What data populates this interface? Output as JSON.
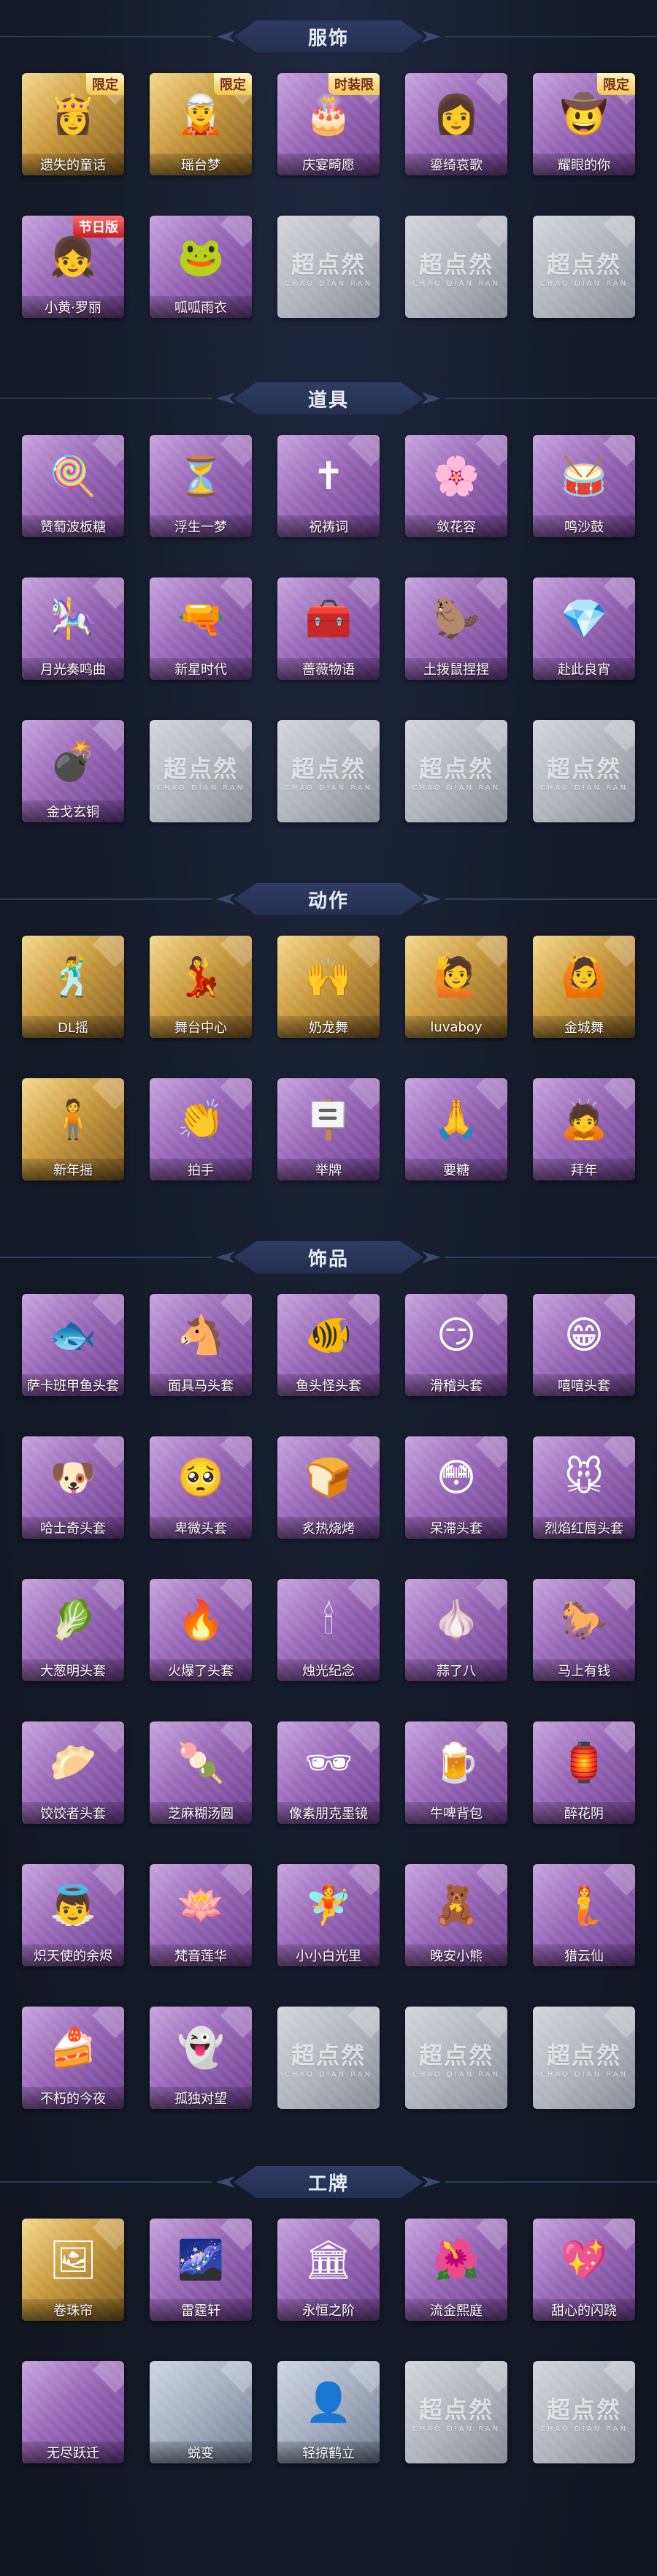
{
  "sections": [
    {
      "title": "服饰",
      "items": [
        {
          "label": "遗失的童话",
          "rarity": "gold",
          "badge": "限定",
          "icon": "princess-avatar",
          "glyph": "👸"
        },
        {
          "label": "瑶台梦",
          "rarity": "gold",
          "badge": "限定",
          "icon": "silver-hair-avatar",
          "glyph": "🧝"
        },
        {
          "label": "庆宴畸愿",
          "rarity": "purple",
          "badge": "时装限",
          "icon": "cake-boy-avatar",
          "glyph": "🎂"
        },
        {
          "label": "鎏绮哀歌",
          "rarity": "purple",
          "badge": "",
          "icon": "lady-avatar",
          "glyph": "👩"
        },
        {
          "label": "耀眼的你",
          "rarity": "purple",
          "badge": "限定",
          "icon": "cowboy-hat-avatar",
          "glyph": "🤠"
        },
        {
          "label": "小黄·罗丽",
          "rarity": "purple",
          "badge": "节日版",
          "icon": "lolita-avatar",
          "glyph": "👧"
        },
        {
          "label": "呱呱雨衣",
          "rarity": "purple",
          "badge": "",
          "icon": "frog-raincoat-avatar",
          "glyph": "🐸"
        },
        {
          "label": "",
          "rarity": "gray",
          "placeholder": true
        },
        {
          "label": "",
          "rarity": "gray",
          "placeholder": true
        },
        {
          "label": "",
          "rarity": "gray",
          "placeholder": true
        }
      ]
    },
    {
      "title": "道具",
      "items": [
        {
          "label": "赞萄波板糖",
          "rarity": "purple",
          "icon": "lollipop-wand",
          "glyph": "🍭"
        },
        {
          "label": "浮生一梦",
          "rarity": "purple",
          "icon": "hourglass",
          "glyph": "⏳"
        },
        {
          "label": "祝祷词",
          "rarity": "purple",
          "icon": "cross-necklace",
          "glyph": "✝"
        },
        {
          "label": "敛花容",
          "rarity": "purple",
          "icon": "hairpin",
          "glyph": "🌸"
        },
        {
          "label": "鸣沙鼓",
          "rarity": "purple",
          "icon": "drum-charm",
          "glyph": "🥁"
        },
        {
          "label": "月光奏鸣曲",
          "rarity": "purple",
          "icon": "music-box",
          "glyph": "🎠"
        },
        {
          "label": "新星时代",
          "rarity": "purple",
          "icon": "revolver",
          "glyph": "🔫"
        },
        {
          "label": "蔷薇物语",
          "rarity": "purple",
          "icon": "medical-box",
          "glyph": "🧰"
        },
        {
          "label": "土拨鼠捏捏",
          "rarity": "purple",
          "icon": "marmot-toy",
          "glyph": "🦫"
        },
        {
          "label": "赴此良宵",
          "rarity": "purple",
          "icon": "gem-crown",
          "glyph": "💎"
        },
        {
          "label": "金戈玄铜",
          "rarity": "purple",
          "icon": "grenade",
          "glyph": "💣"
        },
        {
          "label": "",
          "rarity": "gray",
          "placeholder": true
        },
        {
          "label": "",
          "rarity": "gray",
          "placeholder": true
        },
        {
          "label": "",
          "rarity": "gray",
          "placeholder": true
        },
        {
          "label": "",
          "rarity": "gray",
          "placeholder": true
        }
      ]
    },
    {
      "title": "动作",
      "items": [
        {
          "label": "DL摇",
          "rarity": "gold",
          "icon": "dance-pose",
          "glyph": "🕺"
        },
        {
          "label": "舞台中心",
          "rarity": "gold",
          "icon": "stage-pose",
          "glyph": "💃"
        },
        {
          "label": "奶龙舞",
          "rarity": "gold",
          "icon": "cheer-pose",
          "glyph": "🙌"
        },
        {
          "label": "luvaboy",
          "rarity": "gold",
          "icon": "wave-pose",
          "glyph": "🙋"
        },
        {
          "label": "金城舞",
          "rarity": "gold",
          "icon": "arms-up-pose",
          "glyph": "🙆"
        },
        {
          "label": "新年摇",
          "rarity": "gold",
          "icon": "newyear-pose",
          "glyph": "🧍"
        },
        {
          "label": "拍手",
          "rarity": "purple",
          "icon": "clap-pose",
          "glyph": "👏"
        },
        {
          "label": "举牌",
          "rarity": "purple",
          "icon": "sign-pose",
          "glyph": "🪧"
        },
        {
          "label": "要糖",
          "rarity": "purple",
          "icon": "ask-pose",
          "glyph": "🙏"
        },
        {
          "label": "拜年",
          "rarity": "purple",
          "icon": "bow-pose",
          "glyph": "🙇"
        }
      ]
    },
    {
      "title": "饰品",
      "items": [
        {
          "label": "萨卡班甲鱼头套",
          "rarity": "purple",
          "icon": "fish-mask",
          "glyph": "🐟"
        },
        {
          "label": "面具马头套",
          "rarity": "purple",
          "icon": "horse-mask",
          "glyph": "🐴"
        },
        {
          "label": "鱼头怪头套",
          "rarity": "purple",
          "icon": "green-fish-mask",
          "glyph": "🐠"
        },
        {
          "label": "滑稽头套",
          "rarity": "purple",
          "icon": "funny-face-mask",
          "glyph": "😏"
        },
        {
          "label": "嘻嘻头套",
          "rarity": "purple",
          "icon": "grin-face-mask",
          "glyph": "😁"
        },
        {
          "label": "哈士奇头套",
          "rarity": "purple",
          "icon": "husky-mask",
          "glyph": "🐶"
        },
        {
          "label": "卑微头套",
          "rarity": "purple",
          "icon": "shy-face-mask",
          "glyph": "🥺"
        },
        {
          "label": "炙热烧烤",
          "rarity": "purple",
          "icon": "toast-mask",
          "glyph": "🍞"
        },
        {
          "label": "呆滞头套",
          "rarity": "purple",
          "icon": "stare-face-mask",
          "glyph": "😳"
        },
        {
          "label": "烈焰红唇头套",
          "rarity": "purple",
          "icon": "pikachu-mask",
          "glyph": "🐭"
        },
        {
          "label": "大葱明头套",
          "rarity": "purple",
          "icon": "scallion-mask",
          "glyph": "🥬"
        },
        {
          "label": "火爆了头套",
          "rarity": "purple",
          "icon": "fire-mask",
          "glyph": "🔥"
        },
        {
          "label": "烛光纪念",
          "rarity": "purple",
          "icon": "candle-mask",
          "glyph": "🕯"
        },
        {
          "label": "蒜了八",
          "rarity": "purple",
          "icon": "garlic-mask",
          "glyph": "🧄"
        },
        {
          "label": "马上有钱",
          "rarity": "purple",
          "icon": "red-horse-mask",
          "glyph": "🐎"
        },
        {
          "label": "饺饺者头套",
          "rarity": "purple",
          "icon": "dumpling-mask",
          "glyph": "🥟"
        },
        {
          "label": "芝麻糊汤圆",
          "rarity": "purple",
          "icon": "tangyuan-mask",
          "glyph": "🍡"
        },
        {
          "label": "像素朋克墨镜",
          "rarity": "purple",
          "icon": "pixel-sunglasses",
          "glyph": "🕶"
        },
        {
          "label": "牛啤背包",
          "rarity": "purple",
          "icon": "beer-backpack",
          "glyph": "🍺"
        },
        {
          "label": "醉花阴",
          "rarity": "purple",
          "icon": "flower-lantern",
          "glyph": "🏮"
        },
        {
          "label": "炽天使的余烬",
          "rarity": "purple",
          "icon": "angel-doll",
          "glyph": "👼"
        },
        {
          "label": "梵音莲华",
          "rarity": "purple",
          "icon": "lotus-doll",
          "glyph": "🪷"
        },
        {
          "label": "小小白光里",
          "rarity": "purple",
          "icon": "cat-girl-doll",
          "glyph": "🧚"
        },
        {
          "label": "晚安小熊",
          "rarity": "purple",
          "icon": "bear-charm",
          "glyph": "🧸"
        },
        {
          "label": "猎云仙",
          "rarity": "purple",
          "icon": "fairy-charm",
          "glyph": "🧜"
        },
        {
          "label": "不朽的今夜",
          "rarity": "purple",
          "icon": "pink-cake",
          "glyph": "🍰"
        },
        {
          "label": "孤独对望",
          "rarity": "purple",
          "icon": "ghost-charm",
          "glyph": "👻"
        },
        {
          "label": "",
          "rarity": "gray",
          "placeholder": true
        },
        {
          "label": "",
          "rarity": "gray",
          "placeholder": true
        },
        {
          "label": "",
          "rarity": "gray",
          "placeholder": true
        }
      ]
    },
    {
      "title": "工牌",
      "items": [
        {
          "label": "卷珠帘",
          "rarity": "gold",
          "icon": "red-frame-card",
          "glyph": "🖼"
        },
        {
          "label": "雷霆轩",
          "rarity": "purple",
          "icon": "night-sky-card",
          "glyph": "🌌"
        },
        {
          "label": "永恒之阶",
          "rarity": "purple",
          "icon": "golden-crest-card",
          "glyph": "🏛"
        },
        {
          "label": "流金熙庭",
          "rarity": "purple",
          "icon": "flower-frame-card",
          "glyph": "🌺"
        },
        {
          "label": "甜心的闪跷",
          "rarity": "purple",
          "icon": "pink-heart-card",
          "glyph": "💖"
        },
        {
          "label": "无尽跃迁",
          "rarity": "purple",
          "icon": "blank-card",
          "glyph": ""
        },
        {
          "label": "蜕变",
          "rarity": "silver",
          "icon": "blank-card",
          "glyph": ""
        },
        {
          "label": "轻掠鹤立",
          "rarity": "silver",
          "icon": "silhouette-card",
          "glyph": "👤"
        },
        {
          "label": "",
          "rarity": "gray",
          "placeholder": true
        },
        {
          "label": "",
          "rarity": "gray",
          "placeholder": true
        }
      ]
    }
  ],
  "placeholder_text": {
    "main": "超点然",
    "sub": "CHAO DIAN RAN"
  }
}
